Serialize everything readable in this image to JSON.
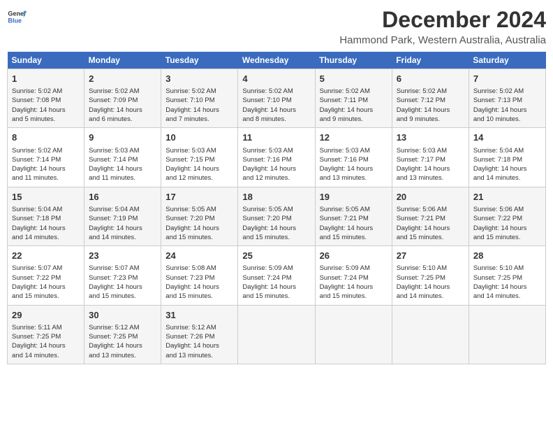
{
  "header": {
    "logo_line1": "General",
    "logo_line2": "Blue",
    "month": "December 2024",
    "location": "Hammond Park, Western Australia, Australia"
  },
  "weekdays": [
    "Sunday",
    "Monday",
    "Tuesday",
    "Wednesday",
    "Thursday",
    "Friday",
    "Saturday"
  ],
  "weeks": [
    [
      {
        "day": "1",
        "info": "Sunrise: 5:02 AM\nSunset: 7:08 PM\nDaylight: 14 hours\nand 5 minutes."
      },
      {
        "day": "2",
        "info": "Sunrise: 5:02 AM\nSunset: 7:09 PM\nDaylight: 14 hours\nand 6 minutes."
      },
      {
        "day": "3",
        "info": "Sunrise: 5:02 AM\nSunset: 7:10 PM\nDaylight: 14 hours\nand 7 minutes."
      },
      {
        "day": "4",
        "info": "Sunrise: 5:02 AM\nSunset: 7:10 PM\nDaylight: 14 hours\nand 8 minutes."
      },
      {
        "day": "5",
        "info": "Sunrise: 5:02 AM\nSunset: 7:11 PM\nDaylight: 14 hours\nand 9 minutes."
      },
      {
        "day": "6",
        "info": "Sunrise: 5:02 AM\nSunset: 7:12 PM\nDaylight: 14 hours\nand 9 minutes."
      },
      {
        "day": "7",
        "info": "Sunrise: 5:02 AM\nSunset: 7:13 PM\nDaylight: 14 hours\nand 10 minutes."
      }
    ],
    [
      {
        "day": "8",
        "info": "Sunrise: 5:02 AM\nSunset: 7:14 PM\nDaylight: 14 hours\nand 11 minutes."
      },
      {
        "day": "9",
        "info": "Sunrise: 5:03 AM\nSunset: 7:14 PM\nDaylight: 14 hours\nand 11 minutes."
      },
      {
        "day": "10",
        "info": "Sunrise: 5:03 AM\nSunset: 7:15 PM\nDaylight: 14 hours\nand 12 minutes."
      },
      {
        "day": "11",
        "info": "Sunrise: 5:03 AM\nSunset: 7:16 PM\nDaylight: 14 hours\nand 12 minutes."
      },
      {
        "day": "12",
        "info": "Sunrise: 5:03 AM\nSunset: 7:16 PM\nDaylight: 14 hours\nand 13 minutes."
      },
      {
        "day": "13",
        "info": "Sunrise: 5:03 AM\nSunset: 7:17 PM\nDaylight: 14 hours\nand 13 minutes."
      },
      {
        "day": "14",
        "info": "Sunrise: 5:04 AM\nSunset: 7:18 PM\nDaylight: 14 hours\nand 14 minutes."
      }
    ],
    [
      {
        "day": "15",
        "info": "Sunrise: 5:04 AM\nSunset: 7:18 PM\nDaylight: 14 hours\nand 14 minutes."
      },
      {
        "day": "16",
        "info": "Sunrise: 5:04 AM\nSunset: 7:19 PM\nDaylight: 14 hours\nand 14 minutes."
      },
      {
        "day": "17",
        "info": "Sunrise: 5:05 AM\nSunset: 7:20 PM\nDaylight: 14 hours\nand 15 minutes."
      },
      {
        "day": "18",
        "info": "Sunrise: 5:05 AM\nSunset: 7:20 PM\nDaylight: 14 hours\nand 15 minutes."
      },
      {
        "day": "19",
        "info": "Sunrise: 5:05 AM\nSunset: 7:21 PM\nDaylight: 14 hours\nand 15 minutes."
      },
      {
        "day": "20",
        "info": "Sunrise: 5:06 AM\nSunset: 7:21 PM\nDaylight: 14 hours\nand 15 minutes."
      },
      {
        "day": "21",
        "info": "Sunrise: 5:06 AM\nSunset: 7:22 PM\nDaylight: 14 hours\nand 15 minutes."
      }
    ],
    [
      {
        "day": "22",
        "info": "Sunrise: 5:07 AM\nSunset: 7:22 PM\nDaylight: 14 hours\nand 15 minutes."
      },
      {
        "day": "23",
        "info": "Sunrise: 5:07 AM\nSunset: 7:23 PM\nDaylight: 14 hours\nand 15 minutes."
      },
      {
        "day": "24",
        "info": "Sunrise: 5:08 AM\nSunset: 7:23 PM\nDaylight: 14 hours\nand 15 minutes."
      },
      {
        "day": "25",
        "info": "Sunrise: 5:09 AM\nSunset: 7:24 PM\nDaylight: 14 hours\nand 15 minutes."
      },
      {
        "day": "26",
        "info": "Sunrise: 5:09 AM\nSunset: 7:24 PM\nDaylight: 14 hours\nand 15 minutes."
      },
      {
        "day": "27",
        "info": "Sunrise: 5:10 AM\nSunset: 7:25 PM\nDaylight: 14 hours\nand 14 minutes."
      },
      {
        "day": "28",
        "info": "Sunrise: 5:10 AM\nSunset: 7:25 PM\nDaylight: 14 hours\nand 14 minutes."
      }
    ],
    [
      {
        "day": "29",
        "info": "Sunrise: 5:11 AM\nSunset: 7:25 PM\nDaylight: 14 hours\nand 14 minutes."
      },
      {
        "day": "30",
        "info": "Sunrise: 5:12 AM\nSunset: 7:25 PM\nDaylight: 14 hours\nand 13 minutes."
      },
      {
        "day": "31",
        "info": "Sunrise: 5:12 AM\nSunset: 7:26 PM\nDaylight: 14 hours\nand 13 minutes."
      },
      {
        "day": "",
        "info": ""
      },
      {
        "day": "",
        "info": ""
      },
      {
        "day": "",
        "info": ""
      },
      {
        "day": "",
        "info": ""
      }
    ]
  ]
}
